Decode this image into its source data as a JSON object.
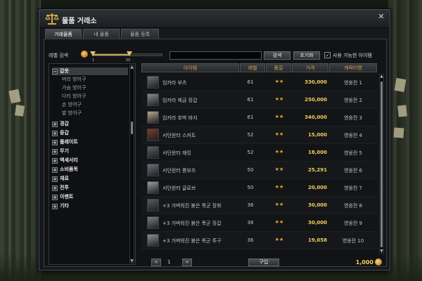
{
  "window": {
    "title": "물품 거래소",
    "close_label": "✕"
  },
  "tabs": [
    {
      "label": "거래물품",
      "active": true
    },
    {
      "label": "내 물품",
      "active": false
    },
    {
      "label": "물품 등록",
      "active": false
    }
  ],
  "filter": {
    "level_label": "레벨 검색",
    "level_min": "1",
    "level_max": "50",
    "search_value": "",
    "search_button": "검색",
    "reset_button": "초기화",
    "usable_checked": true,
    "usable_check_mark": "✓",
    "usable_label": "사용 가능한 아이템"
  },
  "categories": [
    {
      "label": "갑옷",
      "toggle": "−",
      "selected": true
    },
    {
      "label": "머리 방어구",
      "sub": true
    },
    {
      "label": "가슴 방어구",
      "sub": true
    },
    {
      "label": "다리 방어구",
      "sub": true
    },
    {
      "label": "손 방어구",
      "sub": true
    },
    {
      "label": "발 방어구",
      "sub": true
    },
    {
      "label": "경갑",
      "toggle": "+"
    },
    {
      "label": "중갑",
      "toggle": "+"
    },
    {
      "label": "플레이트",
      "toggle": "+"
    },
    {
      "label": "무기",
      "toggle": "+"
    },
    {
      "label": "액세서리",
      "toggle": "+"
    },
    {
      "label": "소비품목",
      "toggle": "+"
    },
    {
      "label": "재료",
      "toggle": "+"
    },
    {
      "label": "전투",
      "toggle": "+"
    },
    {
      "label": "이벤트",
      "toggle": "+"
    },
    {
      "label": "기타",
      "toggle": "+"
    }
  ],
  "table": {
    "headers": [
      "아이템",
      "레벨",
      "품질",
      "가격",
      "캐릭터명"
    ],
    "rows": [
      {
        "icon": "boots-icon",
        "name": "임카라 부츠",
        "level": "61",
        "quality": "★★",
        "price": "330,000",
        "seller": "영웅전 1"
      },
      {
        "icon": "gauntlet-icon",
        "name": "임카라 제금 장갑",
        "level": "61",
        "quality": "★★",
        "price": "250,000",
        "seller": "영웅전 2"
      },
      {
        "icon": "pants-icon",
        "name": "임카라 호박 바지",
        "level": "61",
        "quality": "★★",
        "price": "340,000",
        "seller": "영웅전 3"
      },
      {
        "icon": "skirt-icon",
        "name": "서던윈터 스커트",
        "level": "52",
        "quality": "★★",
        "price": "15,000",
        "seller": "영웅전 4"
      },
      {
        "icon": "jacket-icon",
        "name": "서던윈터 재킷",
        "level": "52",
        "quality": "★★",
        "price": "18,000",
        "seller": "영웅전 5"
      },
      {
        "icon": "long-boots-icon",
        "name": "서던윈터 롱부츠",
        "level": "50",
        "quality": "★★",
        "price": "25,291",
        "seller": "영웅전 6"
      },
      {
        "icon": "gloves-icon",
        "name": "서던윈터 글로브",
        "level": "50",
        "quality": "★★",
        "price": "20,000",
        "seller": "영웅전 7"
      },
      {
        "icon": "shoes-icon",
        "name": "+3 가벼워진 붉은 폭군 장화",
        "level": "36",
        "quality": "★★",
        "price": "30,000",
        "seller": "영웅전 8"
      },
      {
        "icon": "gauntlet-icon",
        "name": "+3 가벼워진 붉은 폭군 장갑",
        "level": "36",
        "quality": "★★",
        "price": "30,000",
        "seller": "영웅전 9"
      },
      {
        "icon": "helmet-icon",
        "name": "+3 가벼워진 붉은 폭군 투구",
        "level": "36",
        "quality": "★★",
        "price": "19,058",
        "seller": "영웅전 10"
      }
    ]
  },
  "footer": {
    "prev_label": "«",
    "page": "1",
    "next_label": "»",
    "buy_button": "구입",
    "money": "1,000"
  },
  "scroll": {
    "up": "▲",
    "down": "▼"
  },
  "colors": {
    "accent_gold": "#d6a24a",
    "price": "#f0d060",
    "stars": "#e2a726"
  }
}
